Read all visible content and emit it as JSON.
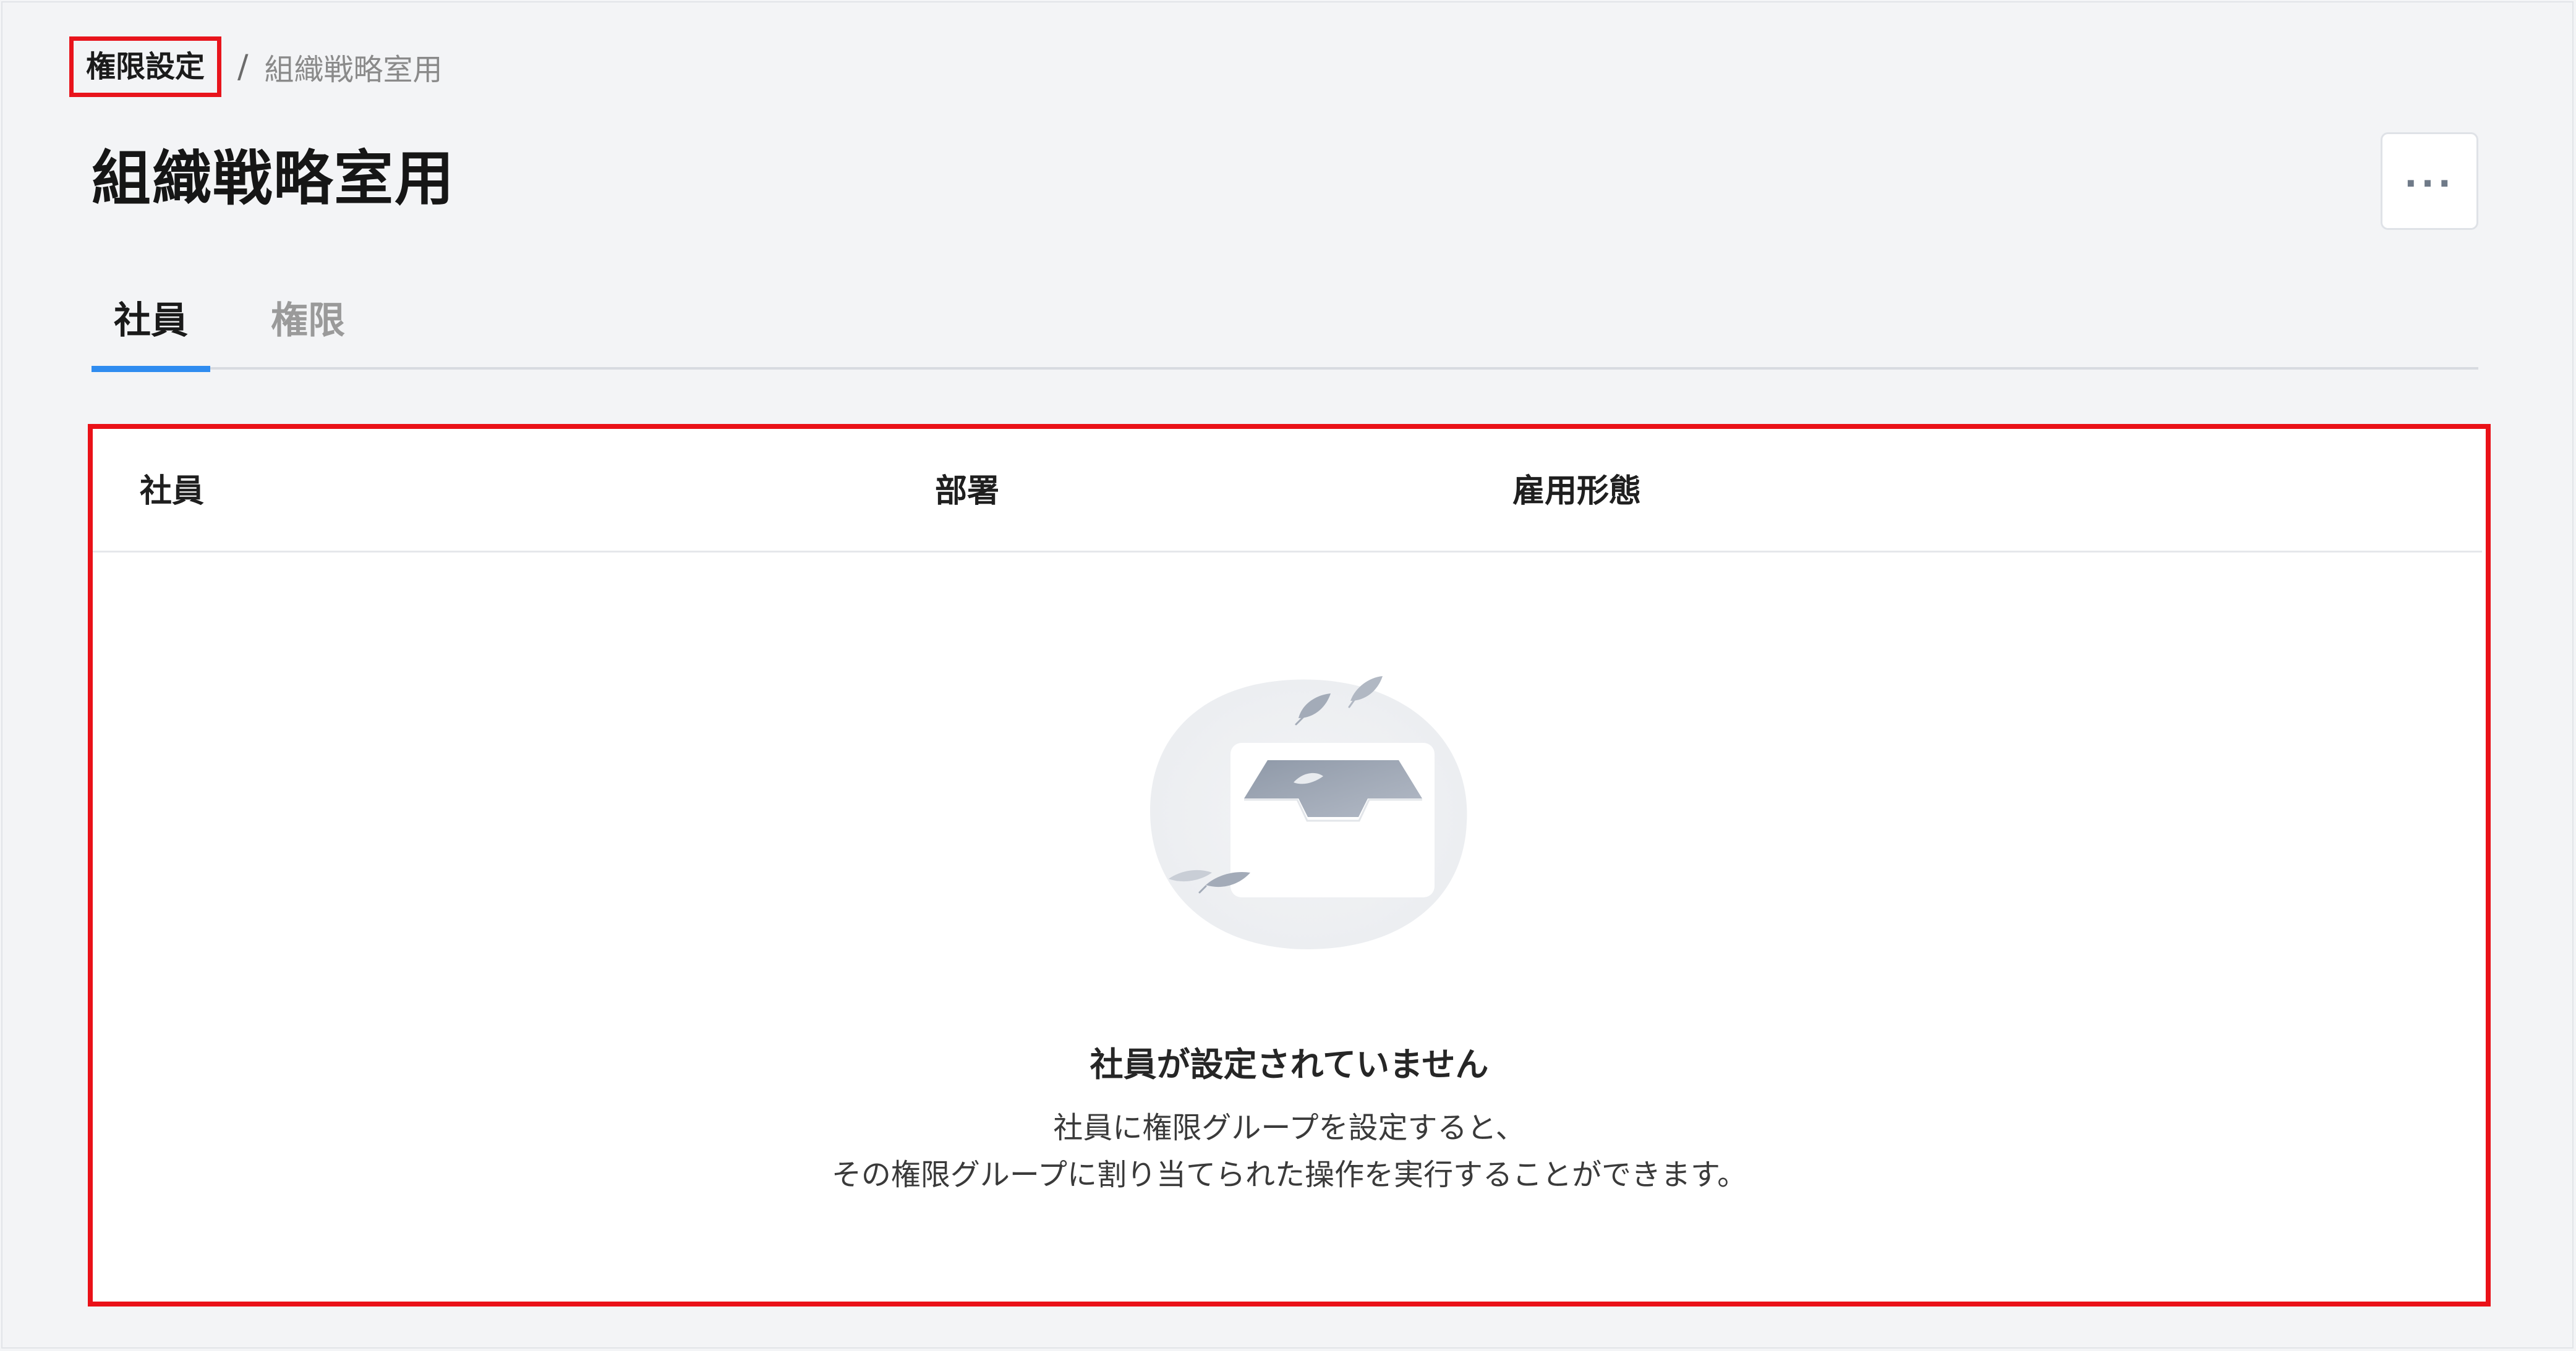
{
  "breadcrumb": {
    "root": "権限設定",
    "separator": "/",
    "current": "組織戦略室用"
  },
  "page": {
    "title": "組織戦略室用",
    "more_button_label": "..."
  },
  "tabs": [
    {
      "label": "社員",
      "active": true
    },
    {
      "label": "権限",
      "active": false
    }
  ],
  "table": {
    "columns": [
      "社員",
      "部署",
      "雇用形態"
    ],
    "rows": []
  },
  "empty_state": {
    "icon": "empty-inbox-icon",
    "title": "社員が設定されていません",
    "description_line1": "社員に権限グループを設定すると、",
    "description_line2": "その権限グループに割り当てられた操作を実行することができます。"
  },
  "colors": {
    "highlight_border": "#ea1118",
    "active_tab_underline": "#2f8cf0",
    "background": "#f3f4f6"
  }
}
